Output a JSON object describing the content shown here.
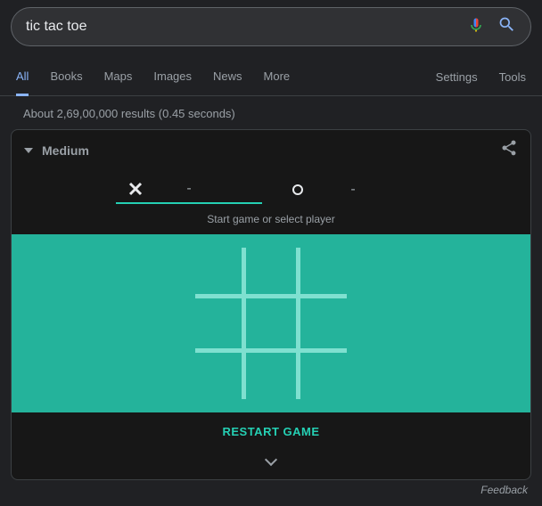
{
  "search": {
    "query": "tic tac toe"
  },
  "tabs": {
    "items": [
      "All",
      "Books",
      "Maps",
      "Images",
      "News",
      "More"
    ],
    "right": [
      "Settings",
      "Tools"
    ]
  },
  "results_info": "About 2,69,00,000 results (0.45 seconds)",
  "game": {
    "difficulty": "Medium",
    "player_x_score": "-",
    "player_o_score": "-",
    "hint": "Start game or select player",
    "restart_label": "RESTART GAME"
  },
  "feedback": "Feedback"
}
